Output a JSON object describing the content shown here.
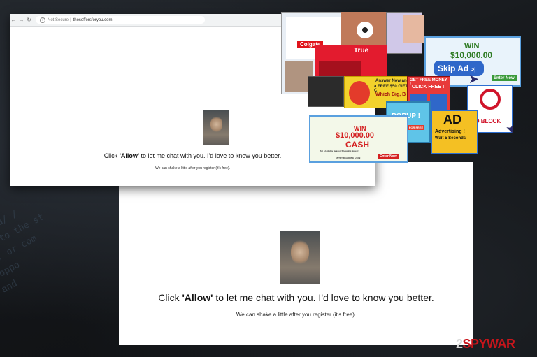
{
  "browser": {
    "security_label": "Not Secure",
    "separator": "|",
    "url": "thesoffersforyou.com"
  },
  "popup": {
    "message_pre": "Click ",
    "message_bold": "'Allow'",
    "message_post": " to let me chat with you. I'd love to know you better.",
    "subtext": "We can shake a little after you register (it's free)."
  },
  "ads": {
    "win_top_line1": "WIN",
    "win_top_line2": "$10,000.00",
    "skip_ad": "Skip Ad",
    "skip_ad_arrow": ">|",
    "enter_now": "Enter Now",
    "free_money": "GET FREE MONEY !",
    "click_free": "CLICK FREE !",
    "answer_now": "Answer Now and",
    "free_gift": "a FREE $50 GIFT C",
    "which_big": "Which Big, B",
    "ad_block": "AD BLOCK",
    "popup_label": "POPUP !",
    "popup_sub": "GET IT NOW FOR FREE",
    "ad_label": "AD",
    "advertising": "Advertising !",
    "wait": "Wait 5 Seconds",
    "win_mid_line1": "WIN",
    "win_mid_line2": "$10,000.00",
    "win_mid_line3": "CASH",
    "win_mid_small": "for a Holiday Season Shopping Spree!",
    "entry_deadline": "ENTRY DEADLINE 1/4/19",
    "colgate": "Colgate",
    "true_label": "True"
  },
  "watermark": {
    "two": "2",
    "spy": "SPYWAR"
  },
  "colors": {
    "brand_red": "#c8151b",
    "ad_yellow": "#f7d32a",
    "ad_blue": "#2d6fd1",
    "ad_green": "#4aa843"
  }
}
